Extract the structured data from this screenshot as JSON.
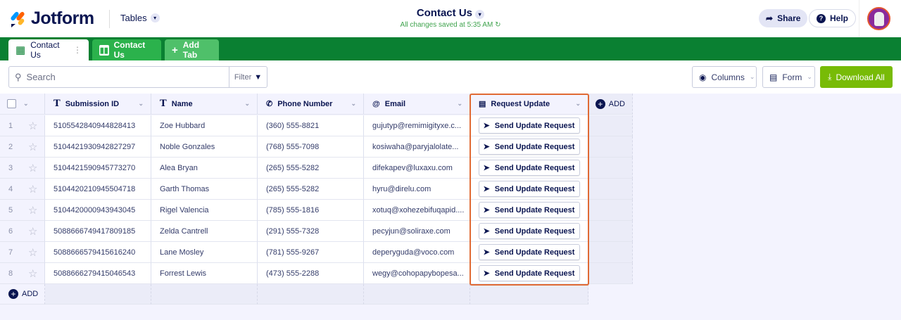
{
  "header": {
    "logo": "Jotform",
    "tables": "Tables",
    "title": "Contact Us",
    "saved": "All changes saved at 5:35 AM",
    "share": "Share",
    "help": "Help"
  },
  "tabs": [
    {
      "label": "Contact Us"
    },
    {
      "label": "Contact Us"
    },
    {
      "label": "Add Tab"
    }
  ],
  "toolbar": {
    "search_placeholder": "Search",
    "filter": "Filter",
    "columns": "Columns",
    "form": "Form",
    "download": "Download All"
  },
  "columns": [
    "Submission ID",
    "Name",
    "Phone Number",
    "Email",
    "Request Update"
  ],
  "add_column": "ADD",
  "add_row": "ADD",
  "button_label": "Send Update Request",
  "rows": [
    [
      "5105542840944828413",
      "Zoe Hubbard",
      "(360) 555-8821",
      "gujutyp@remimigityxe.c..."
    ],
    [
      "5104421930942827297",
      "Noble Gonzales",
      "(768) 555-7098",
      "kosiwaha@paryjalolate..."
    ],
    [
      "5104421590945773270",
      "Alea Bryan",
      "(265) 555-5282",
      "difekapev@luxaxu.com"
    ],
    [
      "5104420210945504718",
      "Garth Thomas",
      "(265) 555-5282",
      "hyru@direlu.com"
    ],
    [
      "5104420000943943045",
      "Rigel Valencia",
      "(785) 555-1816",
      "xotuq@xohezebifuqapid...."
    ],
    [
      "5088666749417809185",
      "Zelda Cantrell",
      "(291) 555-7328",
      "pecyjun@soliraxe.com"
    ],
    [
      "5088666579415616240",
      "Lane Mosley",
      "(781) 555-9267",
      "deperyguda@voco.com"
    ],
    [
      "5088666279415046543",
      "Forrest Lewis",
      "(473) 555-2288",
      "wegy@cohopapybopesa..."
    ]
  ],
  "colors": {
    "green": "#0a8032",
    "accent": "#78bb07",
    "highlight": "#e06a34"
  }
}
